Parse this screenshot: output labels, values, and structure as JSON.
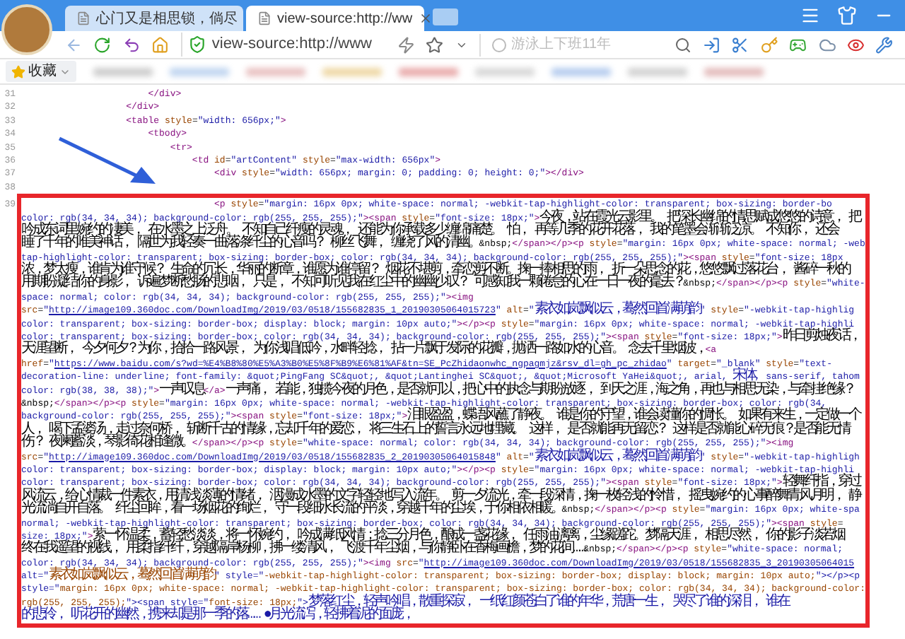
{
  "tabs": [
    {
      "title": "心门又是相思锁，倘尽",
      "selected": false
    },
    {
      "title": "view-source:http://ww",
      "selected": true
    }
  ],
  "address": "view-source:http://www",
  "search": {
    "placeholder": "游泳上下班11年"
  },
  "bookmarks": {
    "label": "收藏"
  },
  "source": {
    "lines": [
      {
        "number": "31",
        "rows": [
          [
            {
              "kind": "code",
              "text": "                       </div>"
            }
          ]
        ]
      },
      {
        "number": "32",
        "rows": [
          [
            {
              "kind": "code",
              "text": "                   </div>"
            }
          ]
        ]
      },
      {
        "number": "33",
        "rows": [
          [
            {
              "kind": "code",
              "text": "                   <table style=\"width: 656px;\">"
            }
          ]
        ]
      },
      {
        "number": "34",
        "rows": [
          [
            {
              "kind": "code",
              "text": "                       <tbody>"
            }
          ]
        ]
      },
      {
        "number": "35",
        "rows": [
          [
            {
              "kind": "code",
              "text": "                           <tr>"
            }
          ]
        ]
      },
      {
        "number": "36",
        "rows": [
          [
            {
              "kind": "code",
              "text": "                               <td id=\"artContent\" style=\"max-width: 656px\">"
            }
          ]
        ]
      },
      {
        "number": "37",
        "rows": [
          [
            {
              "kind": "code",
              "text": "                                   <div style=\"width: 656px; margin: 0; padding: 0; height: 0;\"></div>"
            }
          ]
        ]
      },
      {
        "number": "38"
      },
      {
        "number": "39",
        "rows": [
          [
            {
              "kind": "code",
              "text": "                                   <p style=\"margin: 16px 0px; white-space: normal; -webkit-tap-highlight-color: transparent; box-sizing: border-bo"
            }
          ],
          [
            {
              "kind": "code",
              "text": "color: rgb(34, 34, 34); background-color: rgb(255, 255, 255);\"><span style=\"font-size: 18px;\">今夜，站在霞光云影里。 把深长幽绵的情思赋成悠悠的诗意， 把"
            }
          ],
          [
            {
              "kind": "code",
              "text": "吟成东词里婉约的凄美， 在水墨之上泛舟。 不知自己纤瘦的灵魂， 还能为你承载多少缠绵痛楚。 怕， 再等几季的花开花落， 我的笔墨会渐渐泛凉。 不知你， 还会"
            }
          ],
          [
            {
              "kind": "code",
              "text": "睡了千年的唯美神话， 隔世为我轻奏一曲落涤纤尘的心音吗？ 柳丝飞舞， 缠绕了风的清幽。&nbsp;</span></p><p style=\"margin: 16px 0px; white-space: normal; -web"
            }
          ],
          [
            {
              "kind": "code",
              "text": "tap-highlight-color: transparent; box-sizing: border-box; color: rgb(34, 34, 34); background-color: rgb(255, 255, 255);\"><span style=\"font-size: 18px"
            }
          ],
          [
            {
              "kind": "text",
              "text": "浓，梦太瘦，谁肯为谁守候？ 生命的冗长，华丽的断章，谁愿为谁停留？ 烟花不堪剪，牵恋剪不断。掬一捧相思的雨， 折一朵思念的花，悠悠飘过落花台， 酱碎一秋的"
            }
          ],
          [
            {
              "kind": "code",
              "text": "用期盼凝结你的身影， 诉遍梦断愁肠的悲咽， 只是， 不知可听见我在红尘中的幽幽少叹？ 可感知我一颗倦怠的心在一日一夜的毫去？&nbsp;</span></p><p style=\"white-"
            }
          ],
          [
            {
              "kind": "code",
              "text": "space: normal; color: rgb(34, 34, 34); background-color: rgb(255, 255, 255);\"><img"
            }
          ],
          [
            {
              "kind": "code",
              "text": "src=\""
            },
            {
              "kind": "link",
              "text": "http://image109.360doc.com/DownloadImg/2019/03/0518/155682835_1_20190305064015723"
            },
            {
              "kind": "code",
              "text": "\" alt=\"素衣如岚飘似云，蓦然回首满萌韵\" style=\"-webkit-tap-highlig"
            }
          ],
          [
            {
              "kind": "code",
              "text": "color: transparent; box-sizing: border-box; display: block; margin: 10px auto;\"></p><p style=\"margin: 16px 0px; white-space: normal; -webkit-tap-highli"
            }
          ],
          [
            {
              "kind": "code",
              "text": "color: transparent; box-sizing: border-box; color: rgb(34, 34, 34); background-color: rgb(255, 255, 255);\"><span style=\"font-size: 18px;\">昨日剪烛夜话，"
            }
          ],
          [
            {
              "kind": "code",
              "text": "天涯望断， 今夕何夕？为你，拾拾一路风景， 为你浅唱低吟，水畔轻捻， 拈一片飘于发际的花瓣，抛洒一路如水的心音。 念去千里烟波，<a"
            }
          ],
          [
            {
              "kind": "code",
              "text": "href=\""
            },
            {
              "kind": "link",
              "text": "https://www.baidu.com/s?wd=%E4%B8%80%E5%A3%B0%E5%8F%B9%E6%81%AF&tn=SE_PcZhidaonwhc_ngpagmjz&rsv_dl=gh_pc_zhidao"
            },
            {
              "kind": "code",
              "text": "\" target=\"_blank\" style=\"text-"
            }
          ],
          [
            {
              "kind": "code",
              "text": "decoration-line: underline; font-family: &quot;PingFang SC&quot;, &quot;Lantinghei SC&quot;, &quot;Microsoft YaHei&quot;, arial, 宋体, sans-serif, tahom"
            }
          ],
          [
            {
              "kind": "code",
              "text": "color: rgb(38, 38, 38);\">一声叹息</a>一声痛， 若能，独揽今夜的月色，是否就可以，把心中的执念与期盼放逐， 到天之涯，海之角，再也与相思无染，与牵挂绝缘？"
            }
          ],
          [
            {
              "kind": "code",
              "text": "&nbsp;</span></p><p style=\"margin: 16px 0px; white-space: normal; -webkit-tap-highlight-color: transparent; box-sizing: border-box; color: rgb(34,"
            }
          ],
          [
            {
              "kind": "code",
              "text": "background-color: rgb(255, 255, 255);\"><span style=\"font-size: 18px;\">泪眼盈盈，蝶语风蘸了静夜。 谁是你的守望，谁会读懂你的惆怅。 如果有来生，一定做一个"
            }
          ],
          [
            {
              "kind": "code",
              "text": "人， 喝下孟婆汤，走过奈何桥， 斩断千古的情缘，忘却千年的爱恋， 将三生石上的誓言永远地埋藏。 这样， 是否就能再无留恋？ 这样是否就能心碎无痕？是否能无情"
            }
          ],
          [
            {
              "kind": "code",
              "text": "伤？ 夜阑蓄淡，琴影倚花相逢微。</span></p><p style=\"white-space: normal; color: rgb(34, 34, 34); background-color: rgb(255, 255, 255);\"><img"
            }
          ],
          [
            {
              "kind": "code",
              "text": "src=\""
            },
            {
              "kind": "link",
              "text": "http://image109.360doc.com/DownloadImg/2019/03/0518/155682835_2_20190305064015848"
            },
            {
              "kind": "code",
              "text": "\" alt=\"素衣如岚飘似云，蓦然回首满萌韵\" style=\"-webkit-tap-highligh"
            }
          ],
          [
            {
              "kind": "code",
              "text": "color: transparent; box-sizing: border-box; display: block; margin: 10px auto;\"></p><p style=\"margin: 16px 0px; white-space: normal; -webkit-tap-highli"
            }
          ],
          [
            {
              "kind": "code",
              "text": "color: transparent; box-sizing: border-box; color: rgb(34, 34, 34); background-color: rgb(255, 255, 255);\"><span style=\"font-size: 18px;\">轻舞纤指，穿过"
            }
          ],
          [
            {
              "kind": "code",
              "text": "风流云，给心情裁一件素衣，用清浅淡薄的情绪， 洇漫成水墨的文字轻轻地写入流年。 剪一夕流光，牵一段深情，掬一枚轻浅的怜惜， 摇曳婉约的心事醉舞青风月明， 静"
            }
          ],
          [
            {
              "kind": "code",
              "text": "光流淌自开自落。 纤尘回眸，看一场烟花的绚烂， 守一段细水长流的平淡，穿越千年的尘埃，于你相依相暖。&nbsp;</span></p><p style=\"margin: 16px 0px; white-spa"
            }
          ],
          [
            {
              "kind": "code",
              "text": "normal; -webkit-tap-highlight-color: transparent; box-sizing: border-box; color: rgb(34, 34, 34); background-color: rgb(255, 255, 255);\"><span style="
            }
          ],
          [
            {
              "kind": "value",
              "text": "size: 18px;\""
            },
            {
              "kind": "code",
              "text": ">萦一怀温柔，蓄轻愁淡淡，将一怀婉约， 吟成满纸风情；捻三分月色，酿成一盏花缘， 任雨油漓离，尘缘蹉跎。梦隔天涯， 相思尽然， 你的影子淡若烟"
            }
          ],
          [
            {
              "kind": "code",
              "text": "终在我遥望的视线， 用柔指纤纤，穿越隔岸杨柳，拂一缕清风， 飞渡千年尘烟，与你静卧在香梅画檐，梦的花间……&nbsp;</span></p><p style=\"white-space: normal;"
            }
          ],
          [
            {
              "kind": "code",
              "text": "color: rgb(34, 34, 34); background-color: rgb(255, 255, 255);\"><img src=\""
            },
            {
              "kind": "link",
              "text": "http://image109.360doc.com/DownloadImg/2019/03/0518/155682835_3_20190305064015"
            }
          ],
          [
            {
              "kind": "code",
              "text": "alt=\"素衣如岚飘似云，蓦然回首满萌韵\" style=\"-webkit-tap-highlight-color: transparent; box-sizing: border-box; display: block; margin: 10px auto;\"></p><p"
            }
          ],
          [
            {
              "kind": "code",
              "text": "style=\"margin: 16px 0px; white-space: normal; -webkit-tap-highlight-color: transparent; box-sizing: border-box; color: rgb(34, 34, 34); background-color:"
            }
          ],
          [
            {
              "kind": "code",
              "text": "rgb(255, 255, 255);\"><span style=\"font-size: 18px;\">梦落红尘，轻声吟唱，散重探寂， 一纸红颜苍白了谁的年华，荒唐一生， 哭尽了谁的深泪， 谁在"
            }
          ],
          [
            {
              "kind": "code",
              "text": "的悲伶， 听花开的幽然，携来却是那一季的落…… ●月光流泻，轻拂着泥的面庞，"
            }
          ]
        ]
      }
    ]
  }
}
